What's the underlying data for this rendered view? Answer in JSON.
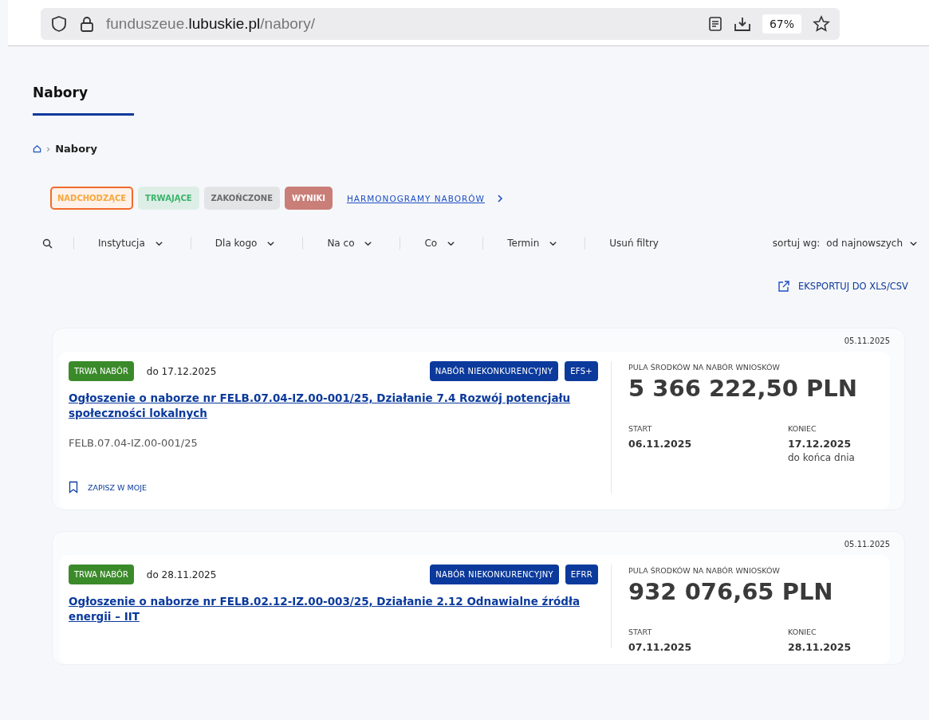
{
  "browser": {
    "url_prefix": "funduszeue.",
    "url_domain": "lubuskie.pl",
    "url_path": "/nabory/",
    "zoom": "67%"
  },
  "page": {
    "title": "Nabory"
  },
  "breadcrumb": {
    "separator": "›",
    "current": "Nabory"
  },
  "status_tabs": [
    {
      "label": "NADCHODZĄCE",
      "selected": true,
      "color": "#f7a73b"
    },
    {
      "label": "TRWAJĄCE",
      "selected": false,
      "color": "#3bb36b"
    },
    {
      "label": "ZAKOŃCZONE",
      "selected": false,
      "color": "#6b6b6b"
    },
    {
      "label": "WYNIKI",
      "selected": false,
      "color": "#c97e78"
    }
  ],
  "schedule_link": "HARMONOGRAMY NABORÓW",
  "filters": [
    "Instytucja",
    "Dla kogo",
    "Na co",
    "Co",
    "Termin"
  ],
  "clear_filters": "Usuń filtry",
  "sort": {
    "label": "sortuj wg:",
    "value": "od najnowszych"
  },
  "export": "EKSPORTUJ DO XLS/CSV",
  "cards": [
    {
      "published": "05.11.2025",
      "status": "TRWA NABÓR",
      "deadline": "do 17.12.2025",
      "tags": [
        "NABÓR NIEKONKURENCYJNY",
        "EFS+"
      ],
      "title": "Ogłoszenie o naborze nr FELB.07.04-IZ.00-001/25, Działanie 7.4 Rozwój potencjału społeczności lokalnych",
      "code": "FELB.07.04-IZ.00-001/25",
      "save": "ZAPISZ W MOJE",
      "pool_label": "PULA ŚRODKÓW NA NABÓR WNIOSKÓW",
      "pool": "5 366 222,50 PLN",
      "start_label": "START",
      "start": "06.11.2025",
      "end_label": "KONIEC",
      "end": "17.12.2025",
      "end_note": "do końca dnia"
    },
    {
      "published": "05.11.2025",
      "status": "TRWA NABÓR",
      "deadline": "do 28.11.2025",
      "tags": [
        "NABÓR NIEKONKURENCYJNY",
        "EFRR"
      ],
      "title": "Ogłoszenie o naborze nr FELB.02.12-IZ.00-003/25, Działanie 2.12 Odnawialne źródła energii – IIT",
      "pool_label": "PULA ŚRODKÓW NA NABÓR WNIOSKÓW",
      "pool": "932 076,65 PLN",
      "start_label": "START",
      "start": "07.11.2025",
      "end_label": "KONIEC",
      "end": "28.11.2025"
    }
  ]
}
